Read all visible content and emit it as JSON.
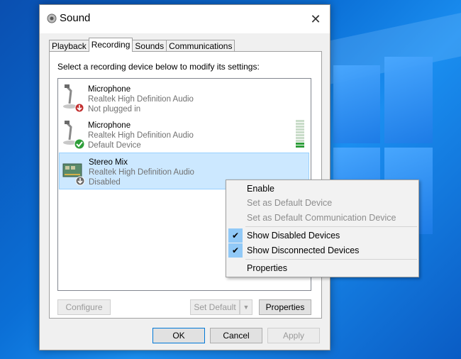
{
  "window": {
    "title": "Sound"
  },
  "tabs": [
    {
      "label": "Playback"
    },
    {
      "label": "Recording"
    },
    {
      "label": "Sounds"
    },
    {
      "label": "Communications"
    }
  ],
  "recording": {
    "instruction": "Select a recording device below to modify its settings:",
    "devices": [
      {
        "name": "Microphone",
        "driver": "Realtek High Definition Audio",
        "status": "Not plugged in"
      },
      {
        "name": "Microphone",
        "driver": "Realtek High Definition Audio",
        "status": "Default Device"
      },
      {
        "name": "Stereo Mix",
        "driver": "Realtek High Definition Audio",
        "status": "Disabled"
      }
    ],
    "buttons": {
      "configure": "Configure",
      "set_default": "Set Default",
      "properties": "Properties"
    }
  },
  "dialog_buttons": {
    "ok": "OK",
    "cancel": "Cancel",
    "apply": "Apply"
  },
  "context_menu": {
    "items": [
      {
        "label": "Enable"
      },
      {
        "label": "Set as Default Device"
      },
      {
        "label": "Set as Default Communication Device"
      },
      {
        "label": "Show Disabled Devices",
        "checked": true
      },
      {
        "label": "Show Disconnected Devices",
        "checked": true
      },
      {
        "label": "Properties"
      }
    ]
  },
  "colors": {
    "selection": "#cce8ff",
    "accent": "#0078d7",
    "check_bg": "#91c9f7",
    "meter_green": "#2e9e3a"
  }
}
